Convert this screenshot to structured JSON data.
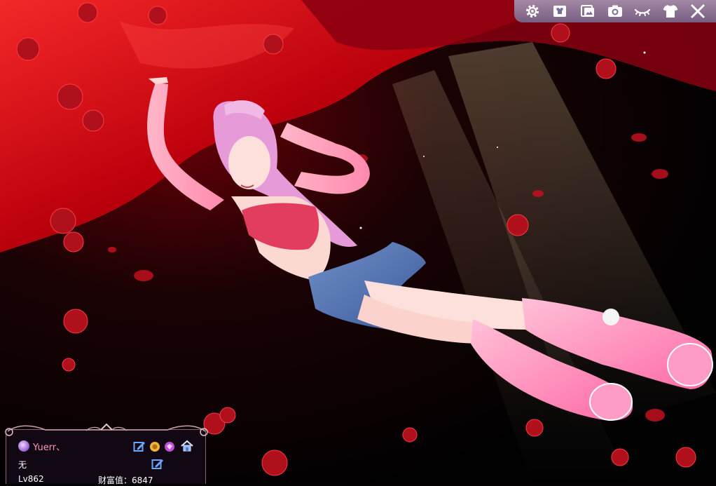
{
  "toolbar": {
    "buttons": [
      {
        "icon": "gear-icon"
      },
      {
        "icon": "wardrobe-icon"
      },
      {
        "icon": "photo-album-icon"
      },
      {
        "icon": "camera-icon"
      },
      {
        "icon": "eye-closed-icon"
      },
      {
        "icon": "shirt-icon"
      },
      {
        "icon": "close-icon"
      }
    ]
  },
  "profile": {
    "player_name": "Yuerr、",
    "guild": "无",
    "level": "Lv862",
    "wealth_label": "财富值：6847"
  },
  "colors": {
    "name_color": "#ff8fc4",
    "toolbar_bg": "#9e94b6",
    "panel_border": "#be8c96"
  }
}
